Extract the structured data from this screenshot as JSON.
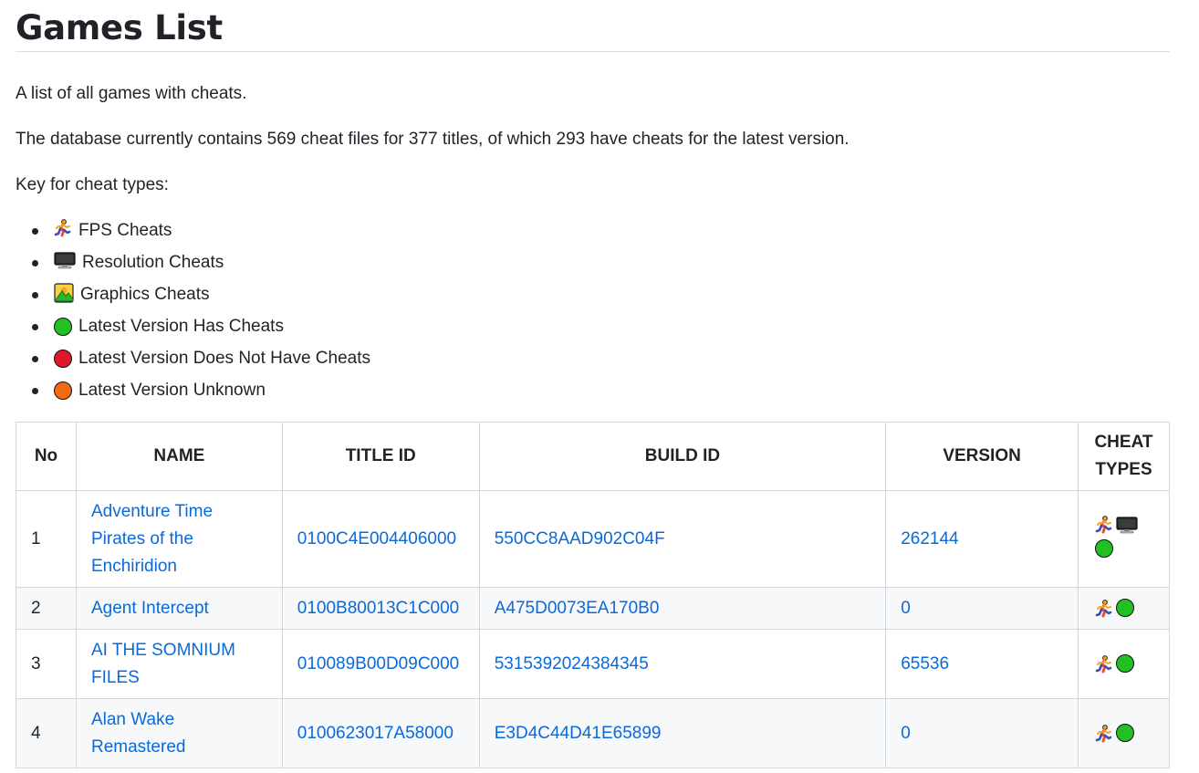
{
  "page": {
    "title": "Games List",
    "intro": "A list of all games with cheats.",
    "stats": "The database currently contains 569 cheat files for 377 titles, of which 293 have cheats for the latest version.",
    "key_heading": "Key for cheat types:"
  },
  "key": [
    {
      "icon": "runner-icon",
      "label": "FPS Cheats"
    },
    {
      "icon": "monitor-icon",
      "label": "Resolution Cheats"
    },
    {
      "icon": "mountain-icon",
      "label": "Graphics Cheats"
    },
    {
      "icon": "green-circle-icon",
      "label": "Latest Version Has Cheats"
    },
    {
      "icon": "red-circle-icon",
      "label": "Latest Version Does Not Have Cheats"
    },
    {
      "icon": "orange-circle-icon",
      "label": "Latest Version Unknown"
    }
  ],
  "colors": {
    "green": "#22c022",
    "red": "#e0182a",
    "orange": "#f26b12",
    "link": "#0969da"
  },
  "table": {
    "headers": {
      "no": "No",
      "name": "NAME",
      "title_id": "TITLE ID",
      "build_id": "BUILD ID",
      "version": "VERSION",
      "cheat_types_line1": "CHEAT",
      "cheat_types_line2": "TYPES"
    },
    "rows": [
      {
        "no": "1",
        "name_lines": [
          "Adventure Time",
          "Pirates of the",
          "Enchiridion"
        ],
        "title_id": "0100C4E004406000",
        "build_id": "550CC8AAD902C04F",
        "version": "262144",
        "cheats": [
          "runner-icon",
          "monitor-icon",
          "green-circle-icon"
        ]
      },
      {
        "no": "2",
        "name_lines": [
          "Agent Intercept"
        ],
        "title_id": "0100B80013C1C000",
        "build_id": "A475D0073EA170B0",
        "version": "0",
        "cheats": [
          "runner-icon",
          "green-circle-icon"
        ]
      },
      {
        "no": "3",
        "name_lines": [
          "AI THE SOMNIUM",
          "FILES"
        ],
        "title_id": "010089B00D09C000",
        "build_id": "5315392024384345",
        "version": "65536",
        "cheats": [
          "runner-icon",
          "green-circle-icon"
        ]
      },
      {
        "no": "4",
        "name_lines": [
          "Alan Wake",
          "Remastered"
        ],
        "title_id": "0100623017A58000",
        "build_id": "E3D4C44D41E65899",
        "version": "0",
        "cheats": [
          "runner-icon",
          "green-circle-icon"
        ]
      }
    ]
  }
}
